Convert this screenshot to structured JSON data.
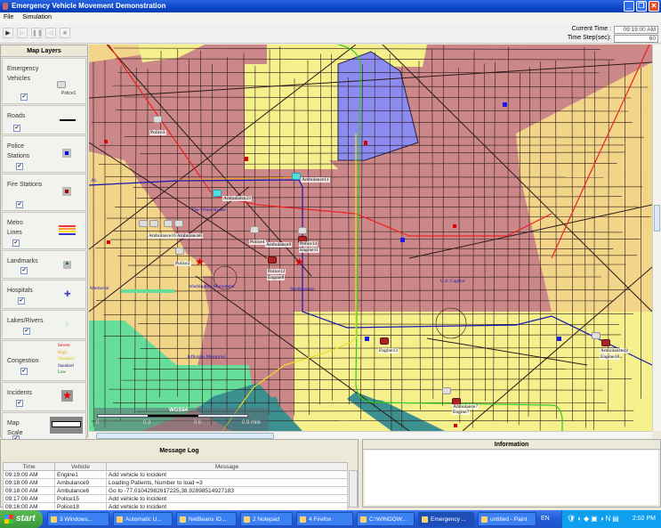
{
  "window": {
    "title": "Emergency Vehicle Movement Demonstration"
  },
  "menu": [
    "File",
    "Simulation"
  ],
  "toolbar": {
    "buttons": [
      "play",
      "step",
      "pause",
      "step-back",
      "stop"
    ],
    "current_time_label": "Current Time :",
    "current_time": "09:19:00 AM",
    "time_step_label": "Time Step(sec):",
    "time_step": "60"
  },
  "layers": {
    "title": "Map Layers",
    "items": [
      {
        "label": "Emergency Vehicles",
        "sample": "Police1",
        "checked": true
      },
      {
        "label": "Roads",
        "checked": true
      },
      {
        "label": "Police Stations",
        "checked": true
      },
      {
        "label": "Fire Stations",
        "checked": true
      },
      {
        "label": "Metro Lines",
        "checked": true
      },
      {
        "label": "Landmarks",
        "checked": true
      },
      {
        "label": "Hospitals",
        "checked": true
      },
      {
        "label": "Lakes/Rivers",
        "checked": true
      },
      {
        "label": "Congestion",
        "checked": true,
        "levels": [
          "Severe",
          "High",
          "Standard",
          "Low"
        ]
      },
      {
        "label": "Incidents",
        "checked": true
      },
      {
        "label": "Map Scale",
        "checked": true
      }
    ]
  },
  "map": {
    "vehicles": [
      "Police3",
      "Ambulance11",
      "Ambulance23",
      "Ambulance16 Ambulance6",
      "Police2",
      "Police4",
      "Ambulance8",
      "Police14",
      "Engine11",
      "Police12",
      "Engine8",
      "Engine13",
      "Ambulance18",
      "Engine18",
      "Ambulance7",
      "Engine7"
    ],
    "landmarks": [
      "The White House",
      "Washington Monument",
      "Smithsonian",
      "U.S. Capitol",
      "Jefferson Memorial",
      "Memorial",
      "AL"
    ],
    "scale": {
      "title": "WGS84",
      "ticks": [
        "0",
        "0.3",
        "0.6",
        "0.9 mile"
      ]
    },
    "colors": {
      "severe": "#cc8888",
      "high": "#f3d58a",
      "standard": "#f5f08c",
      "low": "#66dd99",
      "water": "#3d9090",
      "special": "#8c8cf0"
    }
  },
  "message_log": {
    "title": "Message Log",
    "columns": [
      "Time",
      "Vehicle",
      "Message"
    ],
    "rows": [
      [
        "09:19:00 AM",
        "Engine1",
        "Add vehicle to incident"
      ],
      [
        "09:18:00 AM",
        "Ambulance9",
        "Loading Patients, Number to load =3"
      ],
      [
        "09:18:00 AM",
        "Ambulance6",
        "Go to -77.01042982617225,38.92898514927183"
      ],
      [
        "09:17:00 AM",
        "Police15",
        "Add vehicle to incident"
      ],
      [
        "09:16:00 AM",
        "Police18",
        "Add vehicle to incident"
      ]
    ]
  },
  "information": {
    "title": "Information"
  },
  "taskbar": {
    "start": "start",
    "tasks": [
      "3 Windows...",
      "Automatic U...",
      "NetBeans ID...",
      "2 Notepad",
      "4 Firefox",
      "C:\\WINDOW...",
      "Emergency ...",
      "untitled - Paint"
    ],
    "lang": "EN",
    "clock": "2:02 PM"
  }
}
